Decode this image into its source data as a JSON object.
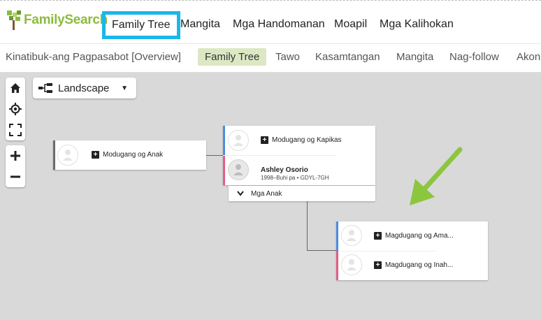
{
  "topnav": {
    "logo": "FamilySearch",
    "items": [
      "Family Tree",
      "Mangita",
      "Mga Handomanan",
      "Moapil",
      "Mga Kalihokan"
    ]
  },
  "subnav": {
    "items": [
      "Kinatibuk-ang Pagpasabot [Overview]",
      "Family Tree",
      "Tawo",
      "Kasamtangan",
      "Mangita",
      "Nag-follow",
      "Akon"
    ]
  },
  "controls": {
    "layout_label": "Landscape",
    "icons": [
      "home-icon",
      "locate-icon",
      "fullscreen-icon",
      "zoom-in-icon",
      "zoom-out-icon"
    ]
  },
  "tree": {
    "left_card": {
      "add_label": "Modugang og Anak"
    },
    "center_card": {
      "add_spouse_label": "Modugang og Kapikas",
      "person_name": "Ashley Osorio",
      "person_details": "1998–Buhi pa • GDYL-7GH",
      "children_label": "Mga Anak"
    },
    "right_card": {
      "father_label": "Magdugang og Ama...",
      "mother_label": "Magdugang og Inah..."
    }
  },
  "colors": {
    "highlight_border": "#1ab7ea",
    "arrow": "#8cc63f",
    "male_bar": "#4b8de0",
    "female_bar": "#e45c83",
    "logo_green": "#8dbb3e"
  }
}
